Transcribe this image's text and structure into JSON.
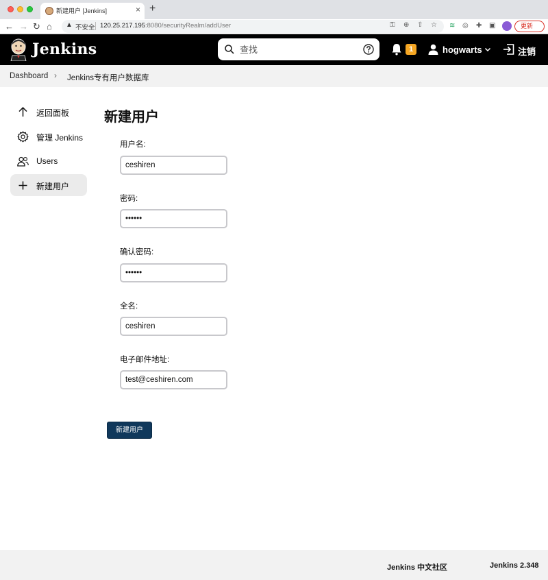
{
  "browser": {
    "tab_title": "新建用户 [Jenkins]",
    "address": {
      "security_label": "不安全",
      "host": "120.25.217.195",
      "path": ":8080/securityRealm/addUser"
    },
    "update_label": "更新"
  },
  "header": {
    "logo_text": "Jenkins",
    "search": {
      "placeholder": "查找",
      "value": ""
    },
    "notification_count": "1",
    "user": "hogwarts",
    "logout_label": "注销"
  },
  "breadcrumbs": [
    {
      "label": "Dashboard"
    },
    {
      "label": "Jenkins专有用户数据库"
    }
  ],
  "sidebar": {
    "items": [
      {
        "label": "返回面板",
        "icon": "arrow-up-icon",
        "active": false
      },
      {
        "label": "管理 Jenkins",
        "icon": "gear-icon",
        "active": false
      },
      {
        "label": "Users",
        "icon": "users-icon",
        "active": false
      },
      {
        "label": "新建用户",
        "icon": "plus-icon",
        "active": true
      }
    ]
  },
  "form": {
    "title": "新建用户",
    "fields": [
      {
        "label": "用户名:",
        "value": "ceshiren",
        "type": "text"
      },
      {
        "label": "密码:",
        "value": "••••••",
        "type": "password"
      },
      {
        "label": "确认密码:",
        "value": "••••••",
        "type": "password"
      },
      {
        "label": "全名:",
        "value": "ceshiren",
        "type": "text"
      },
      {
        "label": "电子邮件地址:",
        "value": "test@ceshiren.com",
        "type": "text"
      }
    ],
    "submit_label": "新建用户"
  },
  "footer": {
    "community_label": "Jenkins 中文社区",
    "version_label": "Jenkins 2.348"
  },
  "colors": {
    "header_bg": "#000000",
    "submit_bg": "#10385b",
    "badge_bg": "#f5a623",
    "update_accent": "#d93025"
  }
}
